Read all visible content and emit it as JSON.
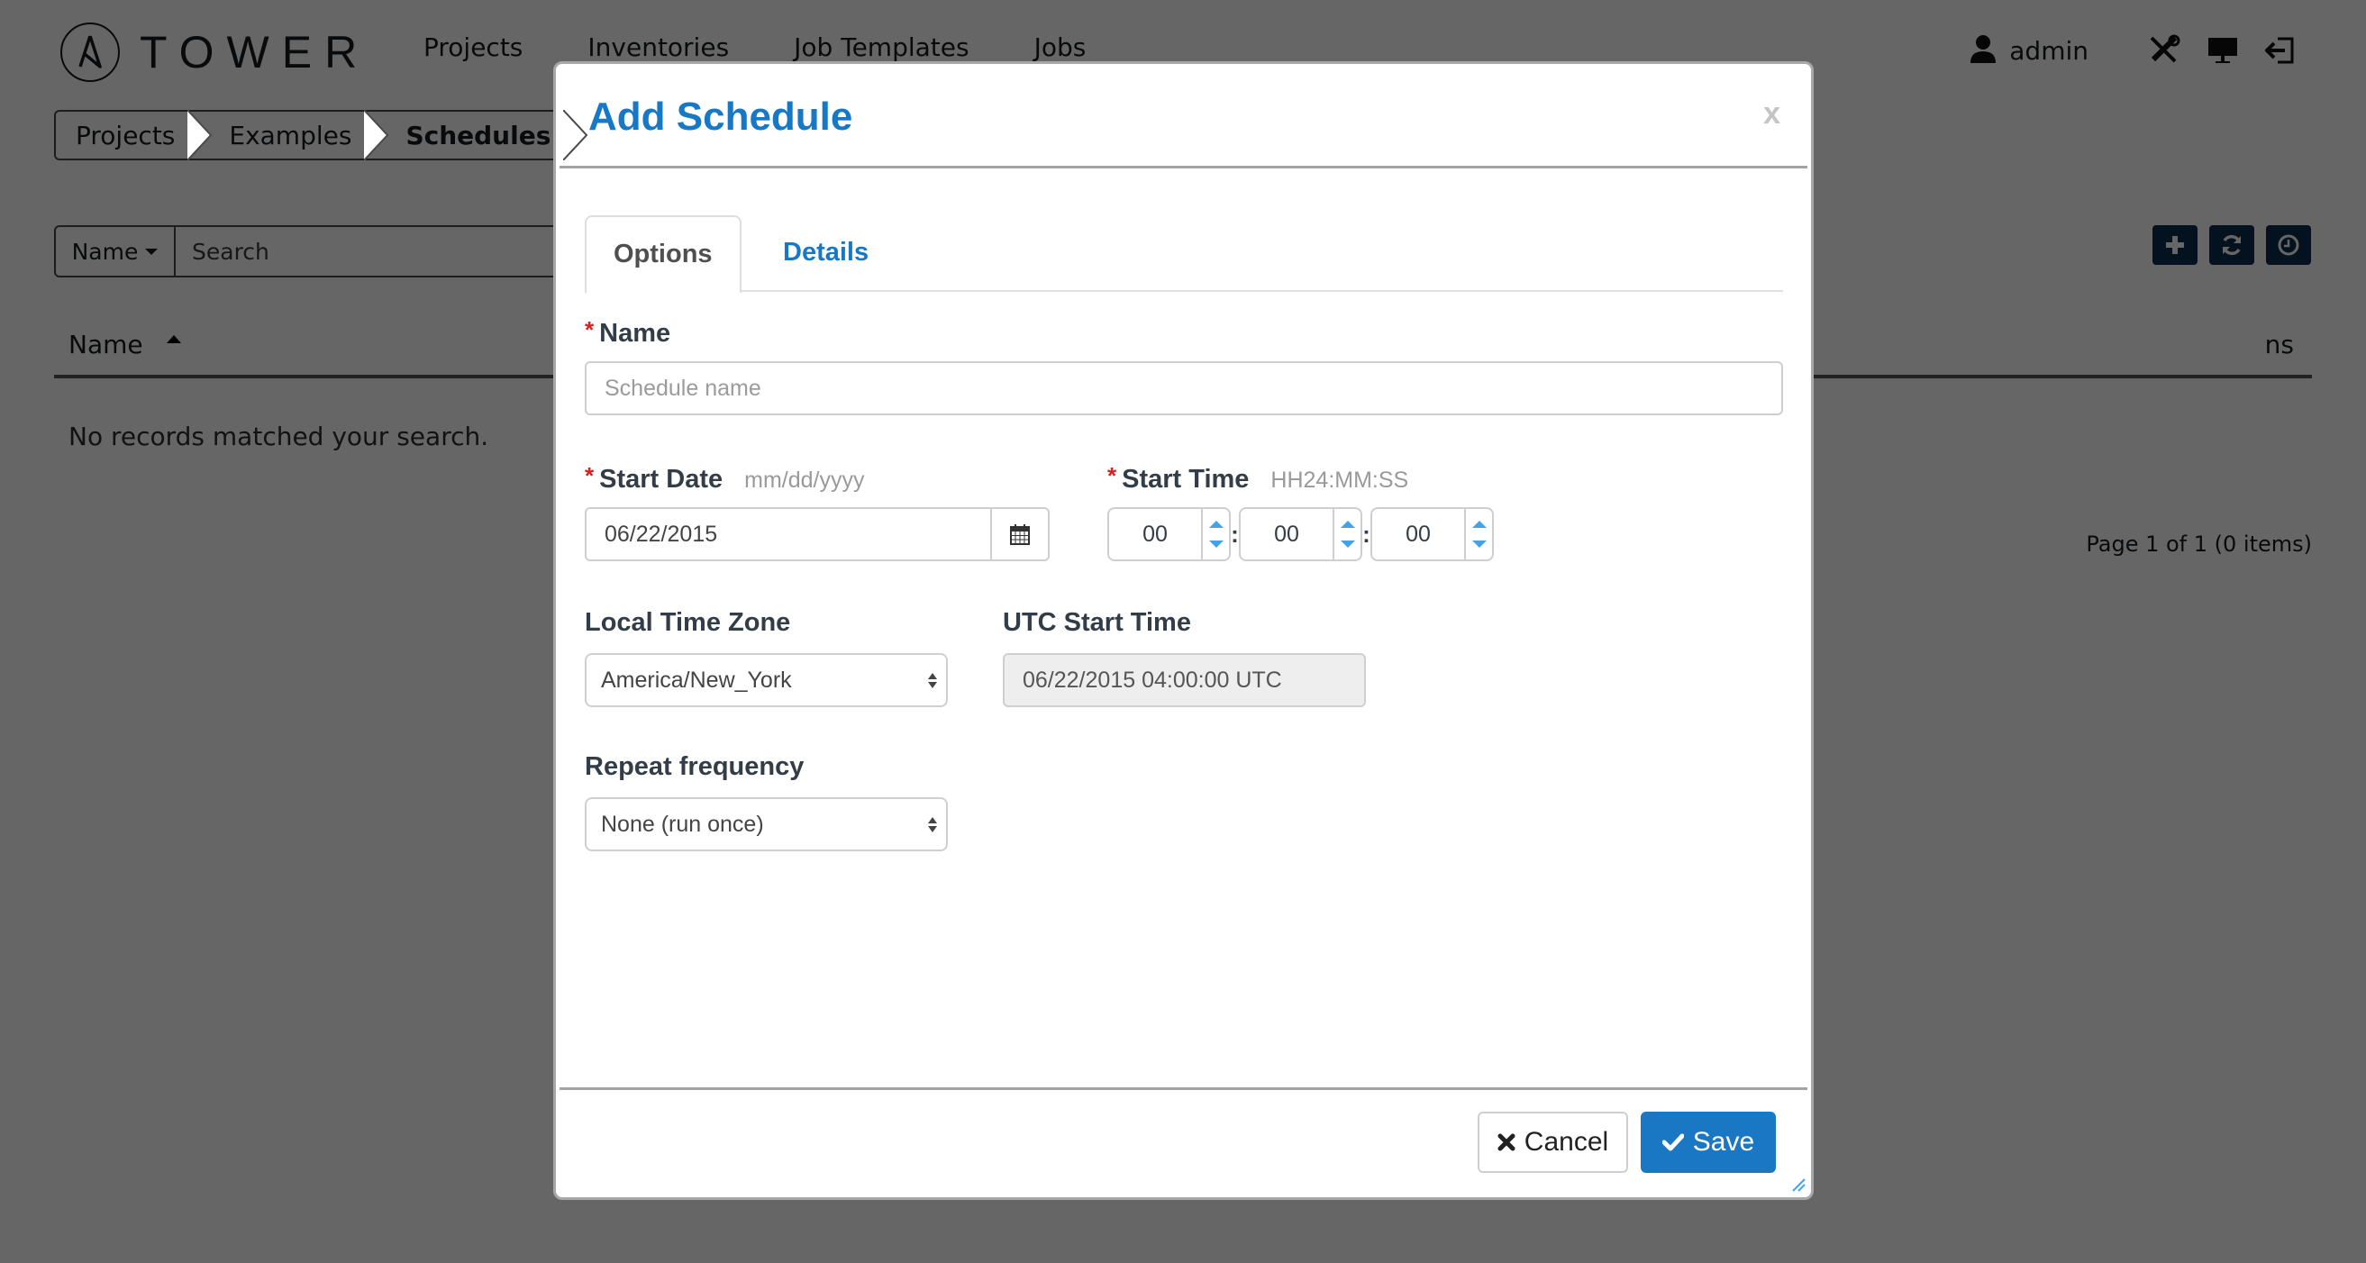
{
  "app": {
    "brand": "TOWER",
    "nav": [
      "Projects",
      "Inventories",
      "Job Templates",
      "Jobs"
    ],
    "user": "admin",
    "nav_icons": [
      "user-icon",
      "tools-icon",
      "monitor-icon",
      "logout-icon"
    ]
  },
  "breadcrumb": [
    "Projects",
    "Examples",
    "Schedules"
  ],
  "search": {
    "filter_label": "Name",
    "placeholder": "Search"
  },
  "toolbar": {
    "icons": [
      "plus-icon",
      "refresh-icon",
      "clock-icon"
    ]
  },
  "table": {
    "columns": [
      "Name",
      "Actions"
    ],
    "visible_actions_fragment": "ns",
    "empty_message": "No records matched your search.",
    "pagination": "Page 1 of 1 (0 items)"
  },
  "modal": {
    "title": "Add Schedule",
    "close_label": "x",
    "tabs": [
      {
        "label": "Options",
        "active": true
      },
      {
        "label": "Details",
        "active": false
      }
    ],
    "name": {
      "label": "Name",
      "required": true,
      "placeholder": "Schedule name",
      "value": ""
    },
    "start_date": {
      "label": "Start Date",
      "required": true,
      "hint": "mm/dd/yyyy",
      "value": "06/22/2015"
    },
    "start_time": {
      "label": "Start Time",
      "required": true,
      "hint": "HH24:MM:SS",
      "hours": "00",
      "minutes": "00",
      "seconds": "00",
      "separator": ":"
    },
    "timezone": {
      "label": "Local Time Zone",
      "value": "America/New_York"
    },
    "utc_start": {
      "label": "UTC Start Time",
      "value": "06/22/2015 04:00:00 UTC"
    },
    "repeat": {
      "label": "Repeat frequency",
      "value": "None (run once)"
    },
    "buttons": {
      "cancel": "Cancel",
      "save": "Save"
    },
    "required_marker": "*"
  },
  "colors": {
    "accent": "#1778c5",
    "save_button": "#1a77c4",
    "required": "#d81f1f",
    "spinner_arrow": "#46a2e6",
    "toolbar_button": "#0b2e50"
  }
}
